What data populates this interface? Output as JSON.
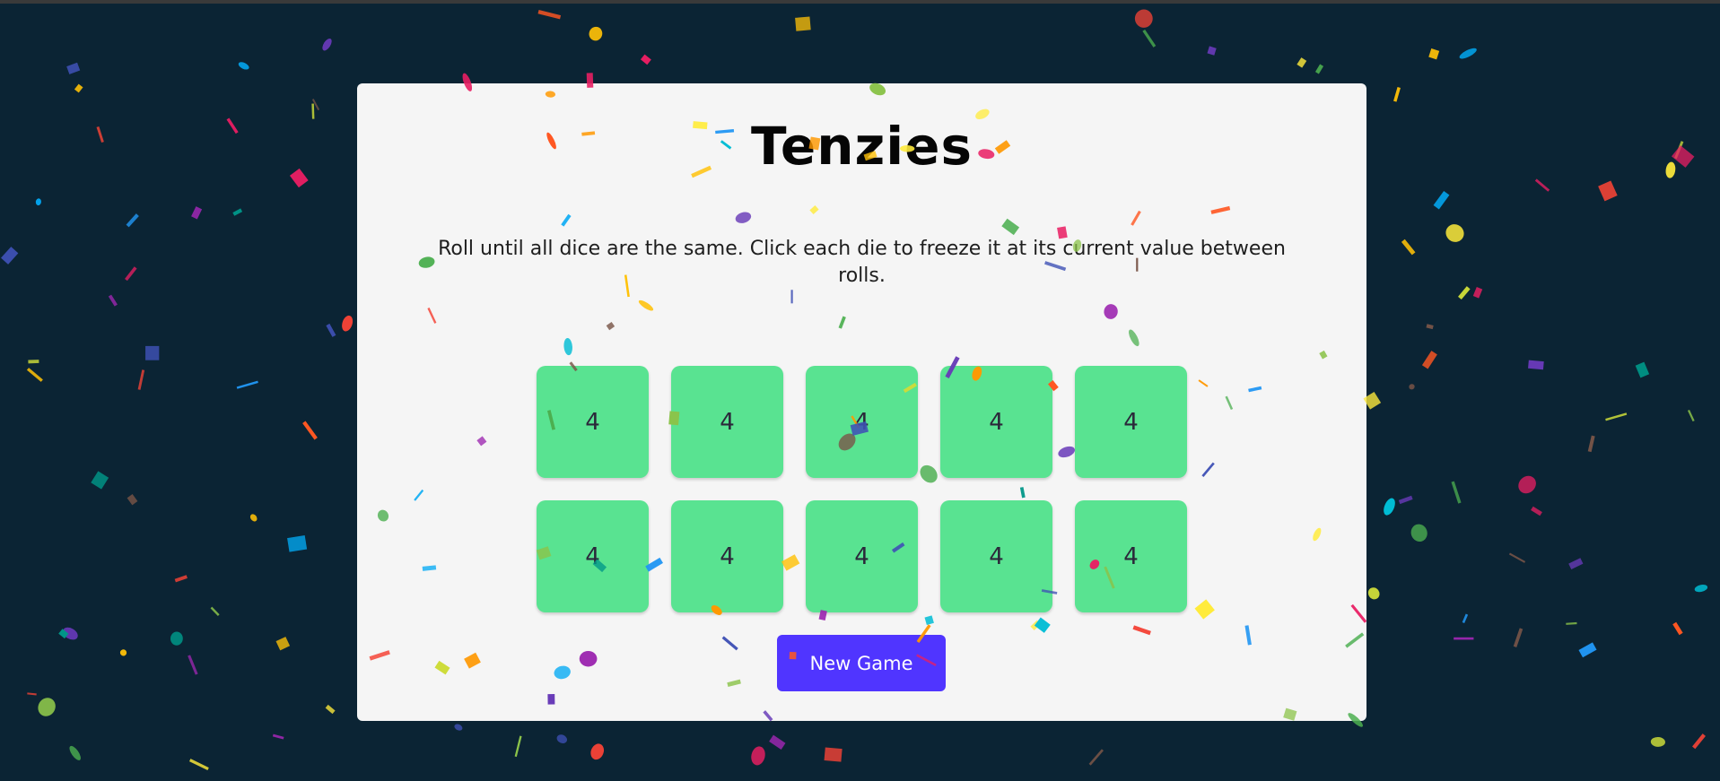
{
  "game": {
    "title": "Tenzies",
    "instructions": "Roll until all dice are the same. Click each die to freeze it at its current value between rolls.",
    "dice": [
      "4",
      "4",
      "4",
      "4",
      "4",
      "4",
      "4",
      "4",
      "4",
      "4"
    ],
    "new_game_label": "New Game"
  },
  "colors": {
    "background": "#0b2434",
    "card": "#f5f5f5",
    "die": "#59e391",
    "die_text": "#2b283a",
    "button": "#5035ff",
    "confetti": [
      "#f44336",
      "#e91e63",
      "#9c27b0",
      "#673ab7",
      "#3f51b5",
      "#2196f3",
      "#03a9f4",
      "#00bcd4",
      "#009688",
      "#4caf50",
      "#8bc34a",
      "#cddc39",
      "#ffeb3b",
      "#ffc107",
      "#ff9800",
      "#ff5722",
      "#795548"
    ]
  }
}
